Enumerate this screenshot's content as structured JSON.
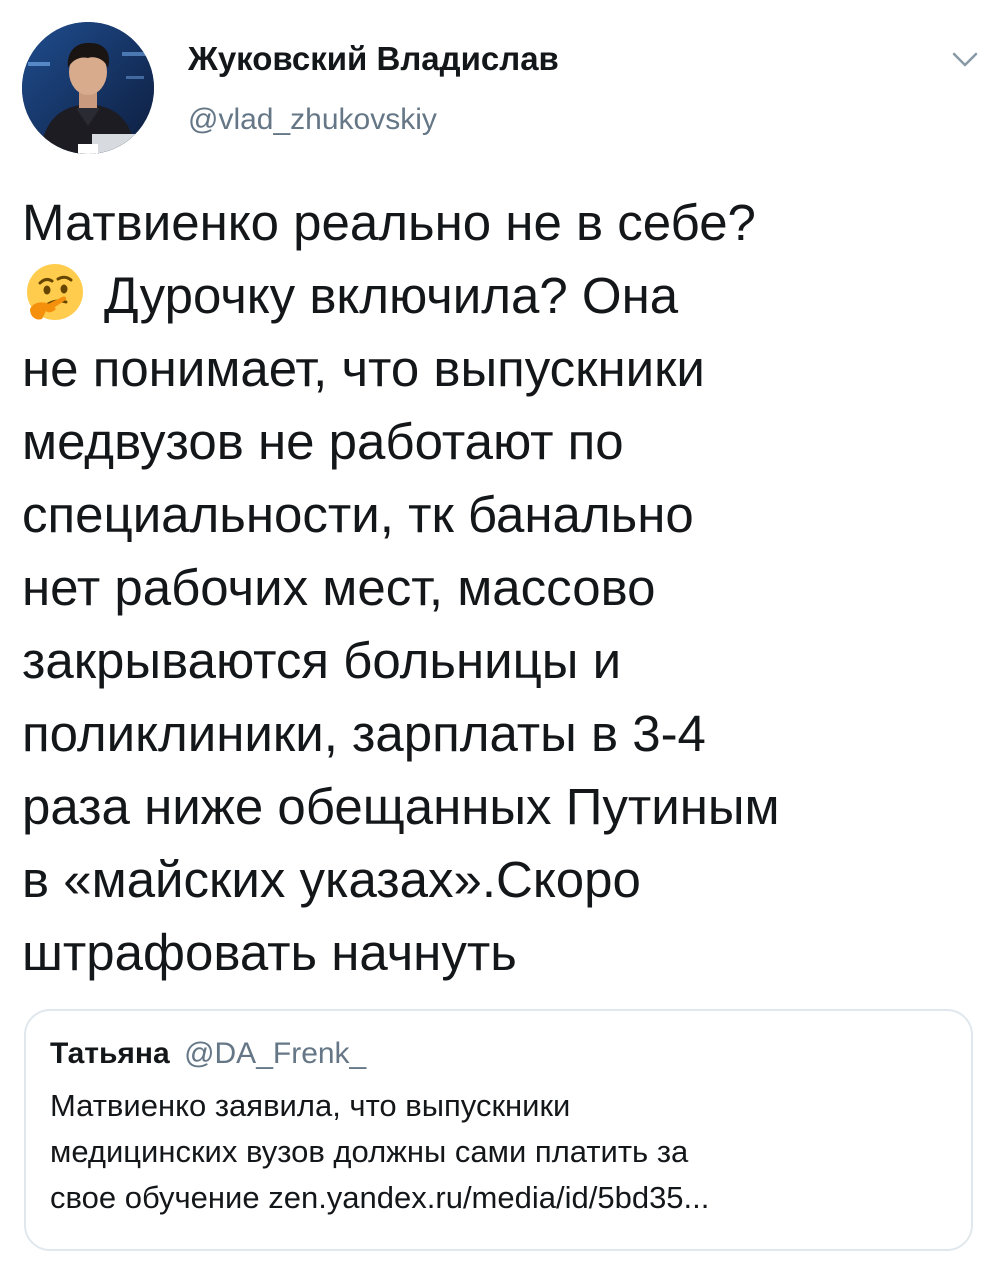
{
  "author": {
    "name": "Жуковский Владислав",
    "handle": "@vlad_zhukovskiy"
  },
  "tweet": {
    "lines": [
      "Матвиенко реально не в себе?",
      "Дурочку включила? Она",
      "не понимает, что выпускники",
      "медвузов не работают по",
      "специальности, тк банально",
      "нет рабочих мест, массово",
      "закрываются больницы и",
      "поликлиники, зарплаты в 3-4",
      "раза ниже обещанных Путиным",
      "в «майских указах».Скоро",
      "штрафовать начнуть"
    ],
    "emoji": "thinking-face"
  },
  "quote": {
    "name": "Татьяна",
    "handle": "@DA_Frenk_",
    "lines": [
      "Матвиенко заявила, что выпускники",
      "медицинских вузов должны сами платить за",
      "свое обучение zen.yandex.ru/media/id/5bd35..."
    ]
  },
  "icons": {
    "caret": "chevron-down-icon"
  },
  "colors": {
    "text": "#14171a",
    "secondary": "#657786",
    "border": "#e1e8ed"
  }
}
